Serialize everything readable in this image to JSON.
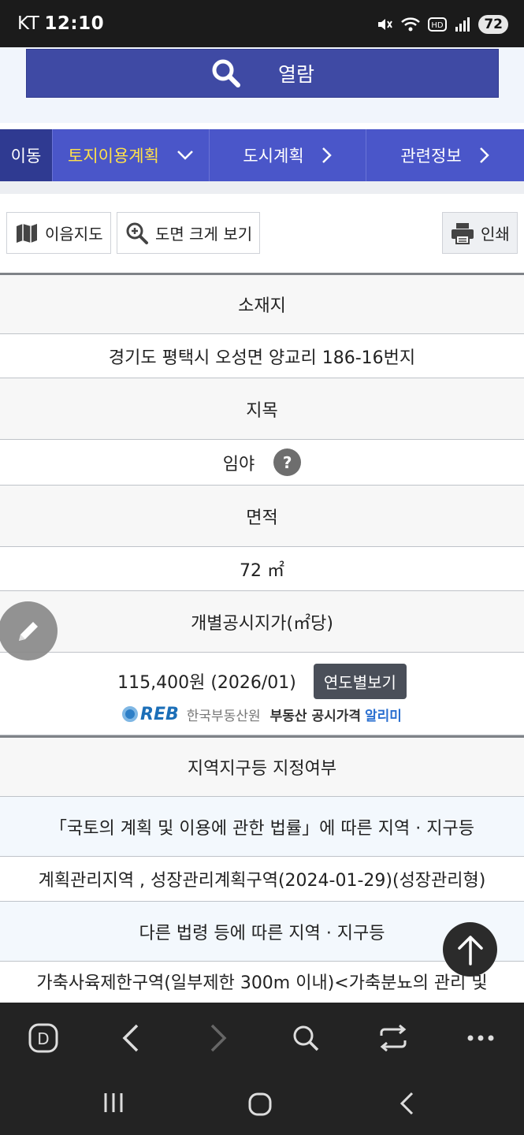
{
  "status": {
    "carrier": "KT",
    "time": "12:10",
    "battery": "72"
  },
  "search": {
    "label": "열람"
  },
  "nav": {
    "move": "이동",
    "land_plan": "토지이용계획",
    "city_plan": "도시계획",
    "related_info": "관련정보"
  },
  "toolbar": {
    "map_label": "이음지도",
    "zoom_label": "도면 크게 보기",
    "print_label": "인쇄"
  },
  "table": {
    "location_header": "소재지",
    "location_value": "경기도 평택시 오성면 양교리 186-16번지",
    "land_category_header": "지목",
    "land_category_value": "임야",
    "help_label": "?",
    "area_header": "면적",
    "area_value": "72 ㎡",
    "price_header": "개별공시지가(㎡당)",
    "price_value": "115,400원 (2026/01)",
    "year_button": "연도별보기",
    "reb_logo": "REB",
    "reb_org": "한국부동산원",
    "reb_service": "부동산 공시가격",
    "reb_service2": "알리미",
    "zone_header": "지역지구등 지정여부",
    "zone_sub1": "「국토의 계획 및 이용에 관한 법률」에 따른 지역 · 지구등",
    "zone_value1": "계획관리지역 , 성장관리계획구역(2024-01-29)(성장관리형)",
    "zone_sub2": "다른 법령 등에 따른 지역 · 지구등",
    "zone_value2": "가축사육제한구역(일부제한 300m 이내)<가축분뇨의 관리 및"
  },
  "colors": {
    "primary": "#3f4aa4",
    "nav_bg": "#4a56c9",
    "nav_active_text": "#ffe14a",
    "dark_bar": "#232323"
  }
}
